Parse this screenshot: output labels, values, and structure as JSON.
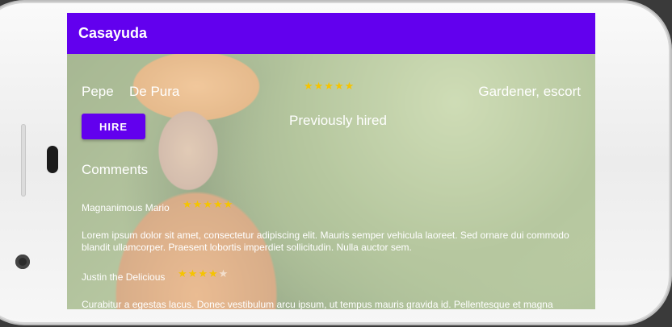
{
  "app": {
    "title": "Casayuda"
  },
  "profile": {
    "first_name": "Pepe",
    "last_name": "De Pura",
    "rating": 4.5,
    "occupation": "Gardener, escort",
    "hire_label": "HIRE",
    "previously_hired_label": "Previously hired"
  },
  "comments": {
    "title": "Comments",
    "items": [
      {
        "author": "Magnanimous Mario",
        "rating": 5,
        "body": "Lorem ipsum dolor sit amet, consectetur adipiscing elit. Mauris semper vehicula laoreet. Sed ornare dui commodo blandit ullamcorper. Praesent lobortis imperdiet sollicitudin. Nulla auctor sem."
      },
      {
        "author": "Justin the Delicious",
        "rating": 3.5,
        "body": "Curabitur a egestas lacus. Donec vestibulum arcu ipsum, ut tempus mauris gravida id. Pellentesque et magna eget est maximus pretium. Maecenas varius sagittis eleifend. Morbi."
      }
    ]
  },
  "colors": {
    "accent": "#6200ee",
    "star": "#f5c400"
  }
}
